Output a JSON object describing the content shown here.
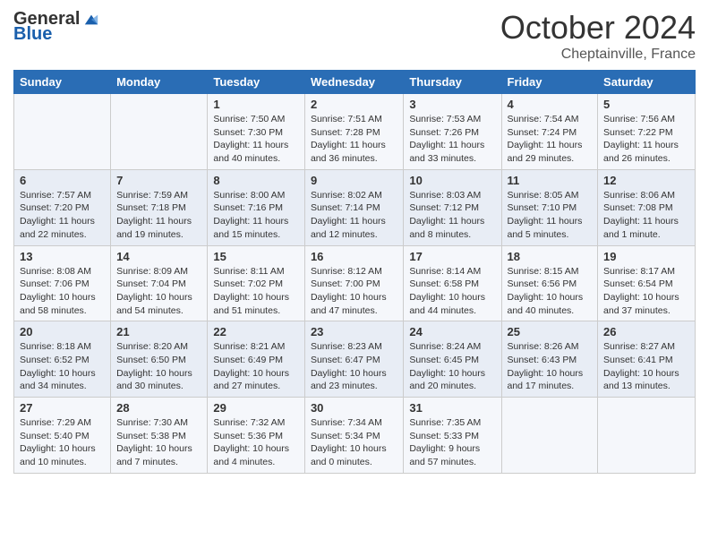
{
  "header": {
    "logo_general": "General",
    "logo_blue": "Blue",
    "month": "October 2024",
    "location": "Cheptainville, France"
  },
  "weekdays": [
    "Sunday",
    "Monday",
    "Tuesday",
    "Wednesday",
    "Thursday",
    "Friday",
    "Saturday"
  ],
  "weeks": [
    [
      null,
      null,
      {
        "day": "1",
        "sunrise": "Sunrise: 7:50 AM",
        "sunset": "Sunset: 7:30 PM",
        "daylight": "Daylight: 11 hours and 40 minutes."
      },
      {
        "day": "2",
        "sunrise": "Sunrise: 7:51 AM",
        "sunset": "Sunset: 7:28 PM",
        "daylight": "Daylight: 11 hours and 36 minutes."
      },
      {
        "day": "3",
        "sunrise": "Sunrise: 7:53 AM",
        "sunset": "Sunset: 7:26 PM",
        "daylight": "Daylight: 11 hours and 33 minutes."
      },
      {
        "day": "4",
        "sunrise": "Sunrise: 7:54 AM",
        "sunset": "Sunset: 7:24 PM",
        "daylight": "Daylight: 11 hours and 29 minutes."
      },
      {
        "day": "5",
        "sunrise": "Sunrise: 7:56 AM",
        "sunset": "Sunset: 7:22 PM",
        "daylight": "Daylight: 11 hours and 26 minutes."
      }
    ],
    [
      {
        "day": "6",
        "sunrise": "Sunrise: 7:57 AM",
        "sunset": "Sunset: 7:20 PM",
        "daylight": "Daylight: 11 hours and 22 minutes."
      },
      {
        "day": "7",
        "sunrise": "Sunrise: 7:59 AM",
        "sunset": "Sunset: 7:18 PM",
        "daylight": "Daylight: 11 hours and 19 minutes."
      },
      {
        "day": "8",
        "sunrise": "Sunrise: 8:00 AM",
        "sunset": "Sunset: 7:16 PM",
        "daylight": "Daylight: 11 hours and 15 minutes."
      },
      {
        "day": "9",
        "sunrise": "Sunrise: 8:02 AM",
        "sunset": "Sunset: 7:14 PM",
        "daylight": "Daylight: 11 hours and 12 minutes."
      },
      {
        "day": "10",
        "sunrise": "Sunrise: 8:03 AM",
        "sunset": "Sunset: 7:12 PM",
        "daylight": "Daylight: 11 hours and 8 minutes."
      },
      {
        "day": "11",
        "sunrise": "Sunrise: 8:05 AM",
        "sunset": "Sunset: 7:10 PM",
        "daylight": "Daylight: 11 hours and 5 minutes."
      },
      {
        "day": "12",
        "sunrise": "Sunrise: 8:06 AM",
        "sunset": "Sunset: 7:08 PM",
        "daylight": "Daylight: 11 hours and 1 minute."
      }
    ],
    [
      {
        "day": "13",
        "sunrise": "Sunrise: 8:08 AM",
        "sunset": "Sunset: 7:06 PM",
        "daylight": "Daylight: 10 hours and 58 minutes."
      },
      {
        "day": "14",
        "sunrise": "Sunrise: 8:09 AM",
        "sunset": "Sunset: 7:04 PM",
        "daylight": "Daylight: 10 hours and 54 minutes."
      },
      {
        "day": "15",
        "sunrise": "Sunrise: 8:11 AM",
        "sunset": "Sunset: 7:02 PM",
        "daylight": "Daylight: 10 hours and 51 minutes."
      },
      {
        "day": "16",
        "sunrise": "Sunrise: 8:12 AM",
        "sunset": "Sunset: 7:00 PM",
        "daylight": "Daylight: 10 hours and 47 minutes."
      },
      {
        "day": "17",
        "sunrise": "Sunrise: 8:14 AM",
        "sunset": "Sunset: 6:58 PM",
        "daylight": "Daylight: 10 hours and 44 minutes."
      },
      {
        "day": "18",
        "sunrise": "Sunrise: 8:15 AM",
        "sunset": "Sunset: 6:56 PM",
        "daylight": "Daylight: 10 hours and 40 minutes."
      },
      {
        "day": "19",
        "sunrise": "Sunrise: 8:17 AM",
        "sunset": "Sunset: 6:54 PM",
        "daylight": "Daylight: 10 hours and 37 minutes."
      }
    ],
    [
      {
        "day": "20",
        "sunrise": "Sunrise: 8:18 AM",
        "sunset": "Sunset: 6:52 PM",
        "daylight": "Daylight: 10 hours and 34 minutes."
      },
      {
        "day": "21",
        "sunrise": "Sunrise: 8:20 AM",
        "sunset": "Sunset: 6:50 PM",
        "daylight": "Daylight: 10 hours and 30 minutes."
      },
      {
        "day": "22",
        "sunrise": "Sunrise: 8:21 AM",
        "sunset": "Sunset: 6:49 PM",
        "daylight": "Daylight: 10 hours and 27 minutes."
      },
      {
        "day": "23",
        "sunrise": "Sunrise: 8:23 AM",
        "sunset": "Sunset: 6:47 PM",
        "daylight": "Daylight: 10 hours and 23 minutes."
      },
      {
        "day": "24",
        "sunrise": "Sunrise: 8:24 AM",
        "sunset": "Sunset: 6:45 PM",
        "daylight": "Daylight: 10 hours and 20 minutes."
      },
      {
        "day": "25",
        "sunrise": "Sunrise: 8:26 AM",
        "sunset": "Sunset: 6:43 PM",
        "daylight": "Daylight: 10 hours and 17 minutes."
      },
      {
        "day": "26",
        "sunrise": "Sunrise: 8:27 AM",
        "sunset": "Sunset: 6:41 PM",
        "daylight": "Daylight: 10 hours and 13 minutes."
      }
    ],
    [
      {
        "day": "27",
        "sunrise": "Sunrise: 7:29 AM",
        "sunset": "Sunset: 5:40 PM",
        "daylight": "Daylight: 10 hours and 10 minutes."
      },
      {
        "day": "28",
        "sunrise": "Sunrise: 7:30 AM",
        "sunset": "Sunset: 5:38 PM",
        "daylight": "Daylight: 10 hours and 7 minutes."
      },
      {
        "day": "29",
        "sunrise": "Sunrise: 7:32 AM",
        "sunset": "Sunset: 5:36 PM",
        "daylight": "Daylight: 10 hours and 4 minutes."
      },
      {
        "day": "30",
        "sunrise": "Sunrise: 7:34 AM",
        "sunset": "Sunset: 5:34 PM",
        "daylight": "Daylight: 10 hours and 0 minutes."
      },
      {
        "day": "31",
        "sunrise": "Sunrise: 7:35 AM",
        "sunset": "Sunset: 5:33 PM",
        "daylight": "Daylight: 9 hours and 57 minutes."
      },
      null,
      null
    ]
  ]
}
